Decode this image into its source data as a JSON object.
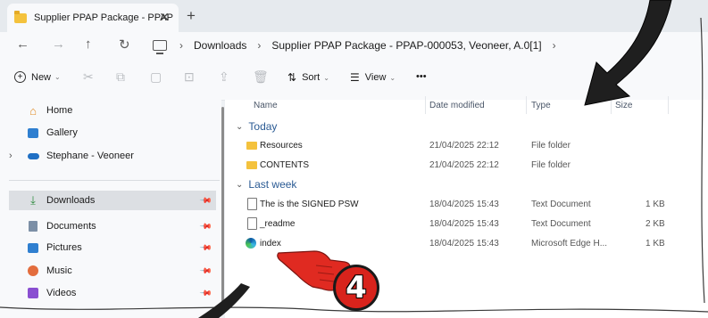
{
  "window": {
    "tab_title": "Supplier PPAP Package - PPAP",
    "tab_close": "✕",
    "new_tab": "+"
  },
  "nav": {
    "back": "←",
    "forward": "→",
    "up": "↑",
    "refresh": "↻",
    "breadcrumb": [
      "Downloads",
      "Supplier PPAP Package - PPAP-000053, Veoneer, A.0[1]"
    ],
    "separator": "›"
  },
  "toolbar": {
    "new_label": "New",
    "sort_label": "Sort",
    "view_label": "View",
    "more_label": "•••"
  },
  "sidebar": {
    "items": [
      {
        "label": "Home",
        "icon": "home-icon"
      },
      {
        "label": "Gallery",
        "icon": "gallery-icon"
      },
      {
        "label": "Stephane - Veoneer",
        "icon": "onedrive-icon"
      },
      {
        "label": "Downloads",
        "icon": "download-icon"
      },
      {
        "label": "Documents",
        "icon": "documents-icon"
      },
      {
        "label": "Pictures",
        "icon": "pictures-icon"
      },
      {
        "label": "Music",
        "icon": "music-icon"
      },
      {
        "label": "Videos",
        "icon": "videos-icon"
      }
    ]
  },
  "columns": {
    "name": "Name",
    "date": "Date modified",
    "type": "Type",
    "size": "Size"
  },
  "groups": [
    {
      "label": "Today",
      "rows": [
        {
          "name": "Resources",
          "date": "21/04/2025 22:12",
          "type": "File folder",
          "size": "",
          "icon": "folder-icon"
        },
        {
          "name": "CONTENTS",
          "date": "21/04/2025 22:12",
          "type": "File folder",
          "size": "",
          "icon": "folder-icon"
        }
      ]
    },
    {
      "label": "Last week",
      "rows": [
        {
          "name": "The is the SIGNED PSW",
          "date": "18/04/2025 15:43",
          "type": "Text Document",
          "size": "1 KB",
          "icon": "text-file-icon"
        },
        {
          "name": "_readme",
          "date": "18/04/2025 15:43",
          "type": "Text Document",
          "size": "2 KB",
          "icon": "text-file-icon"
        },
        {
          "name": "index",
          "date": "18/04/2025 15:43",
          "type": "Microsoft Edge H...",
          "size": "1 KB",
          "icon": "edge-icon"
        }
      ]
    }
  ],
  "annotation": {
    "step_number": "4"
  },
  "colors": {
    "accent": "#2b5b94",
    "annotation_red": "#d8231c"
  }
}
